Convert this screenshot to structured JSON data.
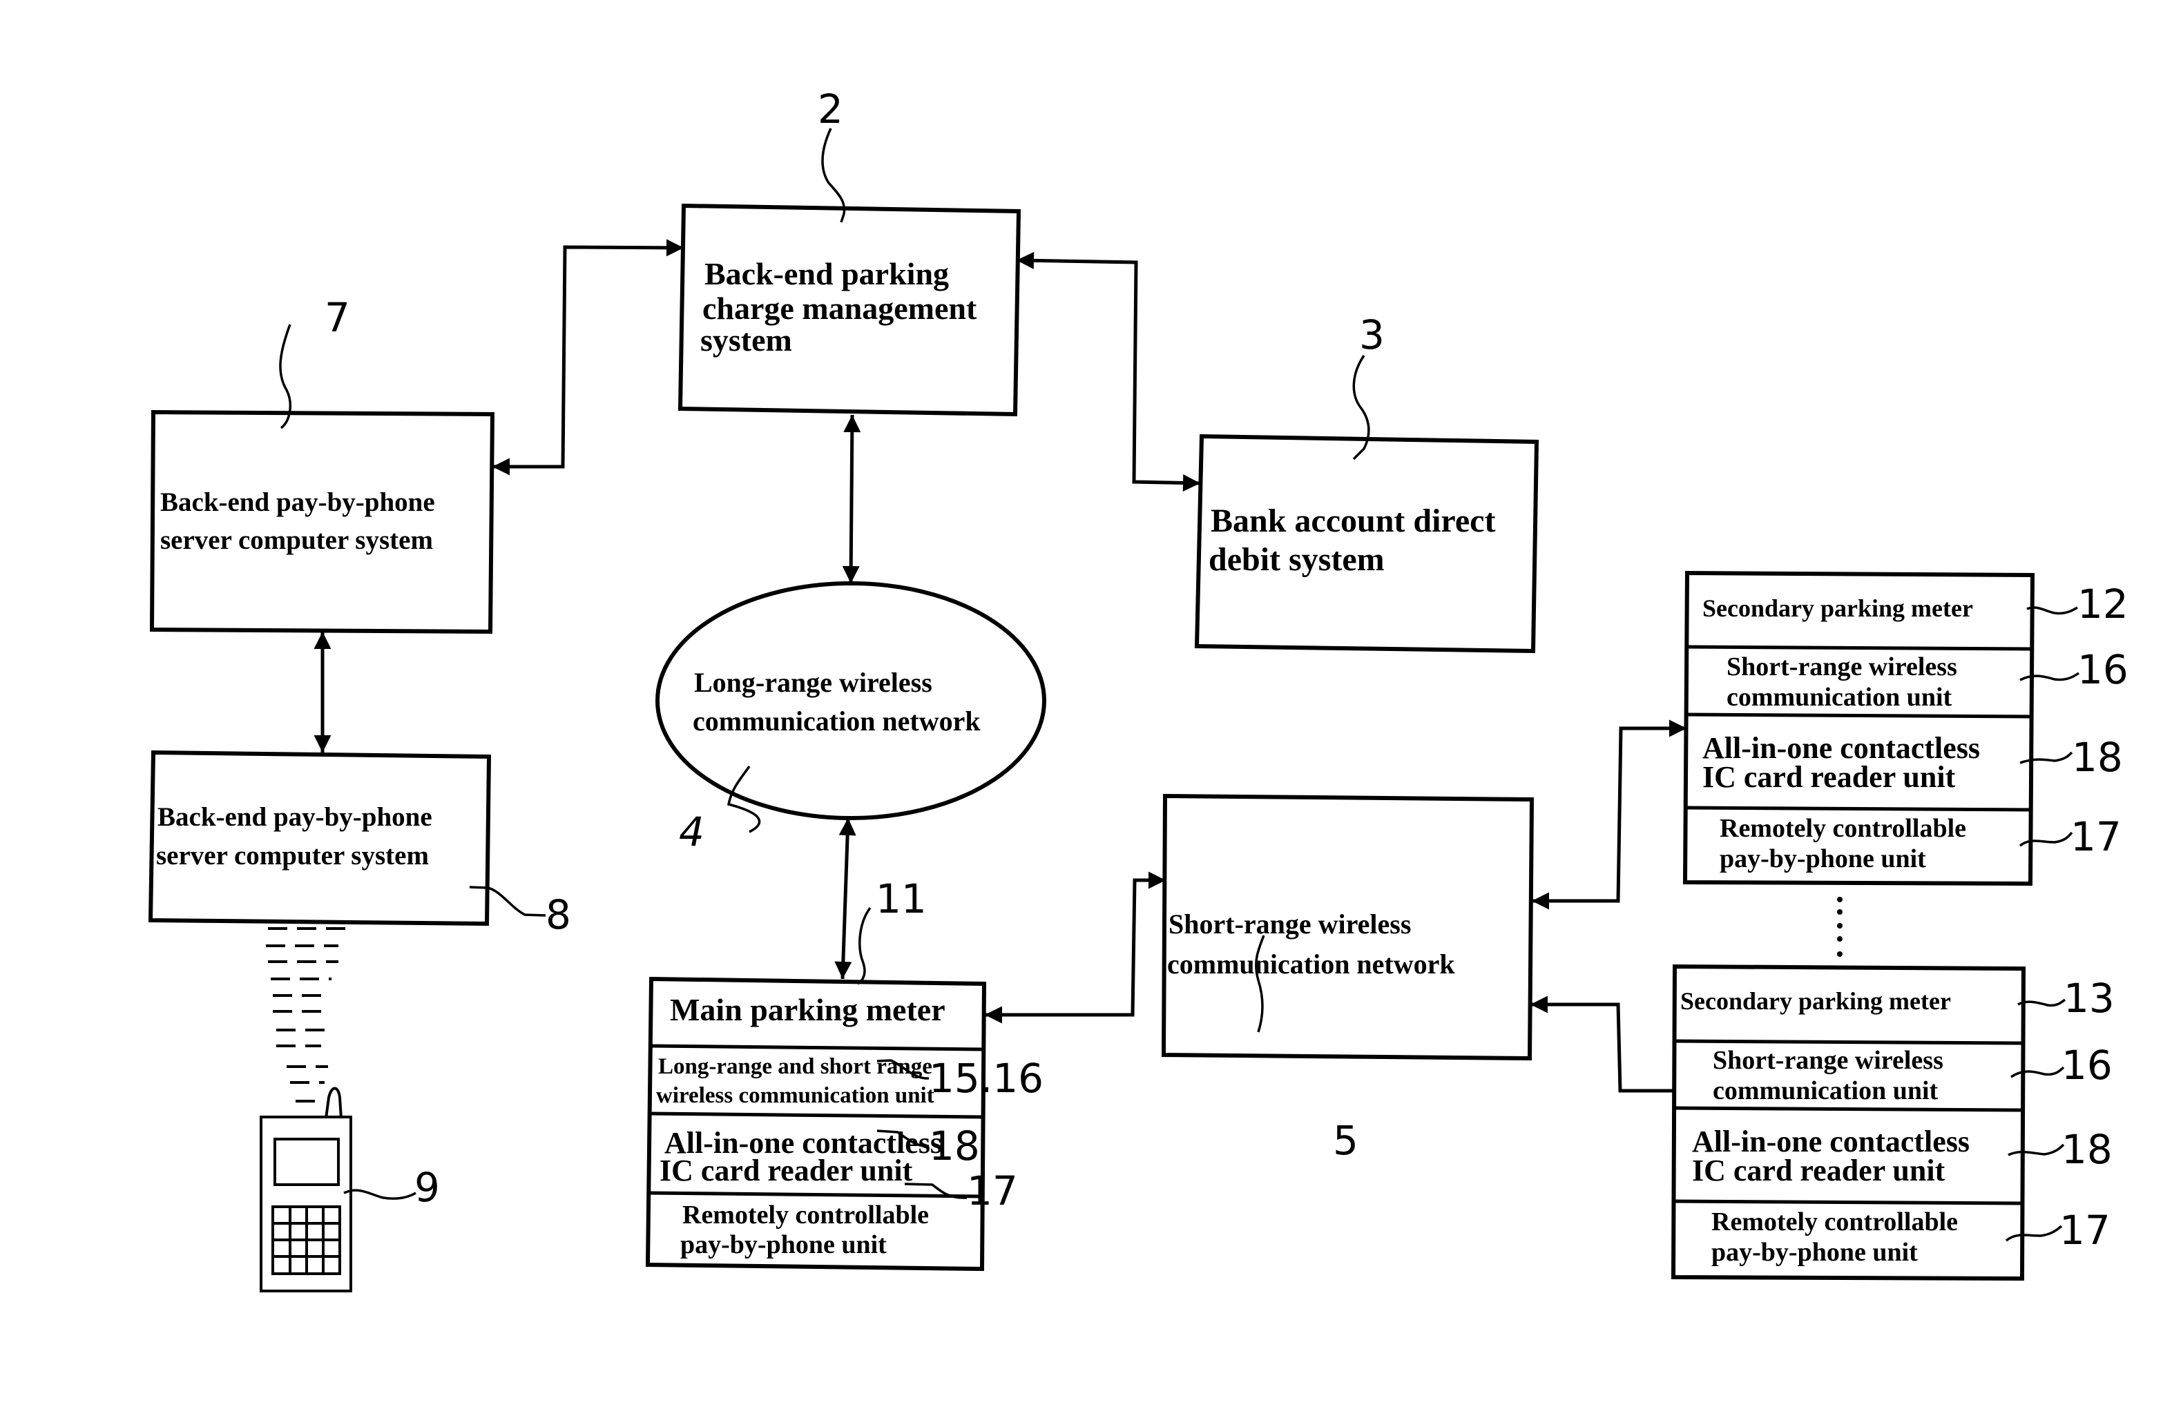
{
  "figure": {
    "nodes": {
      "charge_mgmt": {
        "ref": "2",
        "lines": [
          "Back-end parking",
          "charge management",
          "system"
        ]
      },
      "bank": {
        "ref": "3",
        "lines": [
          "Bank account direct",
          "debit system"
        ]
      },
      "long_range_net": {
        "ref": "4",
        "lines": [
          "Long-range wireless",
          "communication network"
        ]
      },
      "short_range_net": {
        "ref": "5",
        "lines": [
          "Short-range wireless",
          "communication network"
        ]
      },
      "pbp_server_7": {
        "ref": "7",
        "lines": [
          "Back-end pay-by-phone",
          "server computer system"
        ]
      },
      "pbp_server_8": {
        "ref": "8",
        "lines": [
          "Back-end pay-by-phone",
          "server computer system"
        ]
      },
      "phone": {
        "ref": "9"
      },
      "main_meter": {
        "ref": "11",
        "title": "Main parking meter",
        "units": [
          {
            "ref": "15.16",
            "lines": [
              "Long-range and short range",
              "wireless communication unit"
            ]
          },
          {
            "ref": "18",
            "lines": [
              "All-in-one contactless",
              "IC card reader unit"
            ]
          },
          {
            "ref": "17",
            "lines": [
              "Remotely controllable",
              "pay-by-phone unit"
            ]
          }
        ]
      },
      "secondary_meters": [
        {
          "ref": "12",
          "title": "Secondary parking meter",
          "units": [
            {
              "ref": "16",
              "lines": [
                "Short-range wireless",
                "communication unit"
              ]
            },
            {
              "ref": "18",
              "lines": [
                "All-in-one contactless",
                "IC card reader unit"
              ]
            },
            {
              "ref": "17",
              "lines": [
                "Remotely controllable",
                "pay-by-phone unit"
              ]
            }
          ]
        },
        {
          "ref": "13",
          "title": "Secondary parking meter",
          "units": [
            {
              "ref": "16",
              "lines": [
                "Short-range wireless",
                "communication unit"
              ]
            },
            {
              "ref": "18",
              "lines": [
                "All-in-one contactless",
                "IC card reader unit"
              ]
            },
            {
              "ref": "17",
              "lines": [
                "Remotely controllable",
                "pay-by-phone unit"
              ]
            }
          ]
        }
      ]
    },
    "connections": [
      {
        "from": "pbp_server_7",
        "to": "charge_mgmt",
        "type": "bidirectional"
      },
      {
        "from": "charge_mgmt",
        "to": "bank",
        "type": "bidirectional"
      },
      {
        "from": "charge_mgmt",
        "to": "long_range_net",
        "type": "bidirectional"
      },
      {
        "from": "pbp_server_7",
        "to": "pbp_server_8",
        "type": "bidirectional"
      },
      {
        "from": "pbp_server_8",
        "to": "phone",
        "type": "wireless"
      },
      {
        "from": "long_range_net",
        "to": "main_meter",
        "type": "bidirectional"
      },
      {
        "from": "main_meter",
        "to": "short_range_net",
        "type": "bidirectional"
      },
      {
        "from": "short_range_net",
        "to": "secondary_meter_12",
        "type": "bidirectional"
      },
      {
        "from": "short_range_net",
        "to": "secondary_meter_13",
        "type": "bidirectional"
      }
    ]
  }
}
